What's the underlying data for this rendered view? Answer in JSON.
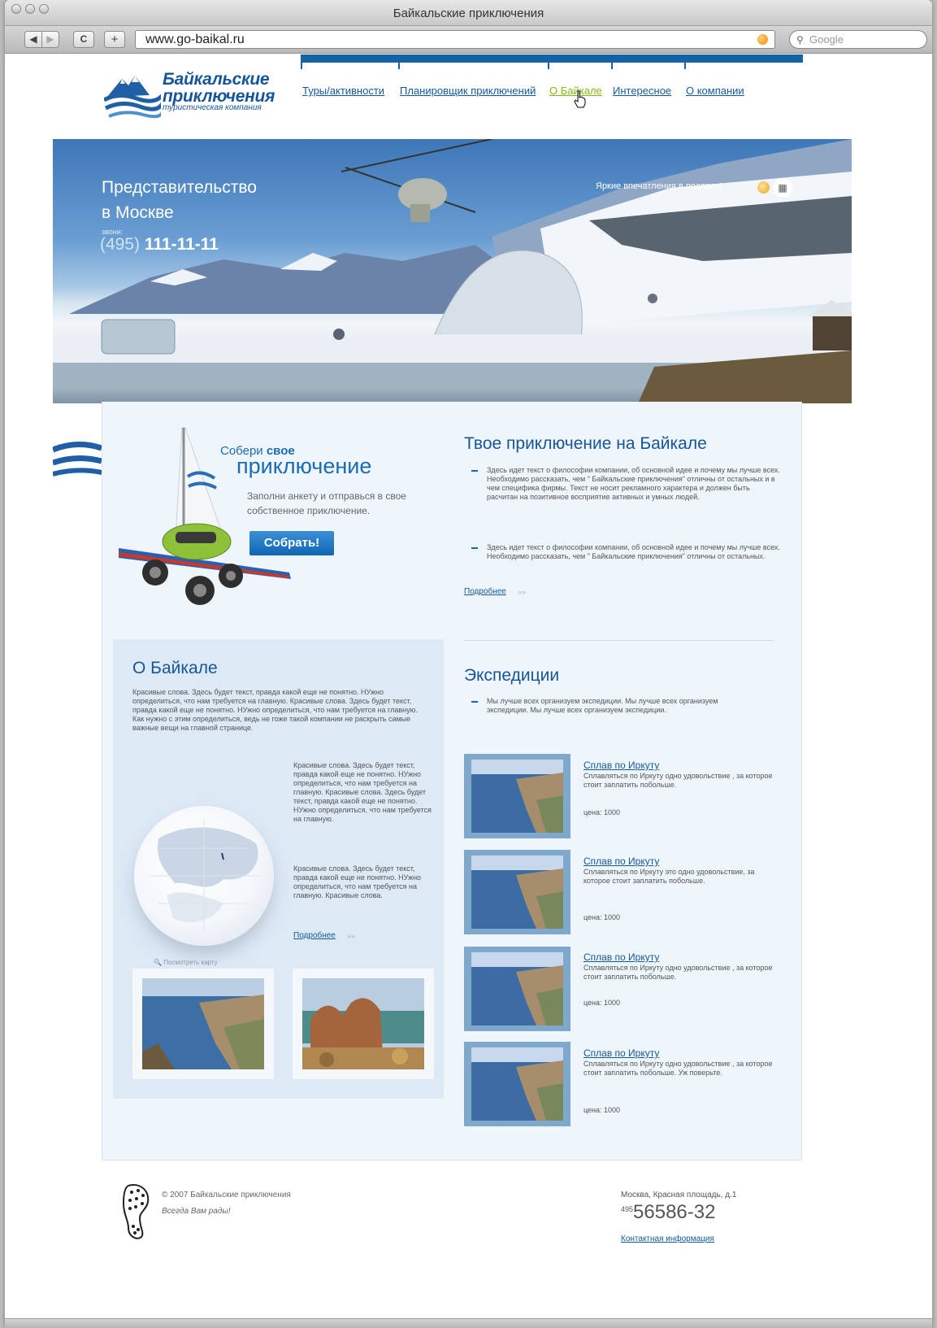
{
  "browser": {
    "window_title": "Байкальские приключения",
    "url": "www.go-baikal.ru",
    "search_placeholder": "Google",
    "nav_back": "◀",
    "nav_forward": "▶",
    "reload": "C",
    "add": "+"
  },
  "logo": {
    "line1": "Байкальские",
    "line2": "приключения",
    "tagline": "туристическая компания"
  },
  "nav": {
    "items": [
      "Туры/активности",
      "Планировщик приключений",
      "О Байкале",
      "Интересное",
      "О компании"
    ],
    "active_index": 2,
    "active_color": "#86b817"
  },
  "hero": {
    "office_line1": "Представительство",
    "office_line2": "в Москве",
    "call_label": "звони:",
    "phone_code": "(495)",
    "phone_number": "111-11-11",
    "gift_text": "Яркие впечатления в подарок!"
  },
  "promo": {
    "title_pre": "Собери ",
    "title_bold": "свое",
    "title_main": "приключение",
    "text": "Заполни анкету и отправься в свое собственное приключение.",
    "button": "Собрать!"
  },
  "adventure": {
    "heading": "Твое приключение на Байкале",
    "paragraphs": [
      "Здесь идет текст о философии компании, об основной идее и почему мы лучше всех. Необходимо рассказать, чем \" Байкальские приключения\" отличны от остальных и в чем специфика фирмы. Текст не носит рекламного характера и должен быть расчитан на позитивное восприятие активных и умных людей.",
      "Здесь идет текст о философии компании, об основной идее и почему мы лучше всех. Необходимо рассказать, чем \" Байкальские приключения\" отличны от остальных."
    ],
    "more": "Подробнее",
    "more_arrow": "»»"
  },
  "about": {
    "heading": "О Байкале",
    "intro": "Красивые слова. Здесь будет текст, правда какой еще не понятно. НУжно определиться, что нам требуется на главную. Красивые слова. Здесь будет текст, правда какой еще не понятно. НУжно определиться, что нам требуется на главную. Как нужно с этим определиться, ведь не гоже такой компании не раскрыть самые важные вещи на главной странице.",
    "side_1": "Красивые слова. Здесь будет текст, правда какой еще не понятно. НУжно определиться, что нам требуется на главную. Красивые слова. Здесь будет текст, правда какой еще не понятно. НУжно определиться, что нам требуется на главную.",
    "side_2": "Красивые слова. Здесь будет текст, правда какой еще не понятно. НУжно определиться, что нам требуется на главную. Красивые слова.",
    "map_link": "Посмотреть карту",
    "more": "Подробнее",
    "more_arrow": "»»"
  },
  "expeditions": {
    "heading": "Экспедиции",
    "intro": "Мы лучше всех организуем экспедиции. Мы лучше всех организуем экспедиции. Мы лучше всех организуем экспедиции.",
    "items": [
      {
        "title": "Сплав по Иркуту",
        "desc": "Сплавляться по Иркуту одно удовольствие , за которое стоит заплатить побольше.",
        "price": "цена: 1000"
      },
      {
        "title": "Сплав по Иркуту",
        "desc": "Сплавляться по Иркуту это одно удовольствие, за которое стоит заплатить побольше.",
        "price": "цена: 1000"
      },
      {
        "title": "Сплав по Иркуту",
        "desc": "Сплавляться по Иркуту одно удовольствие , за которое стоит заплатить побольше.",
        "price": "цена: 1000"
      },
      {
        "title": "Сплав по Иркуту",
        "desc": "Сплавляться по Иркуту одно удовольствие , за которое стоит заплатить побольше. Уж поверьте.",
        "price": "цена: 1000"
      }
    ]
  },
  "footer": {
    "copyright": "© 2007 Байкальские приключения",
    "slogan": "Всегда Вам рады!",
    "address": "Москва, Красная площадь, д.1",
    "phone_code": "495",
    "phone": "56586-32",
    "contact_link": "Контактная информация"
  },
  "colors": {
    "brand_blue": "#17559a",
    "link_blue": "#15599f",
    "nav_bar": "#1463a8",
    "content_bg": "#eef5fb"
  }
}
